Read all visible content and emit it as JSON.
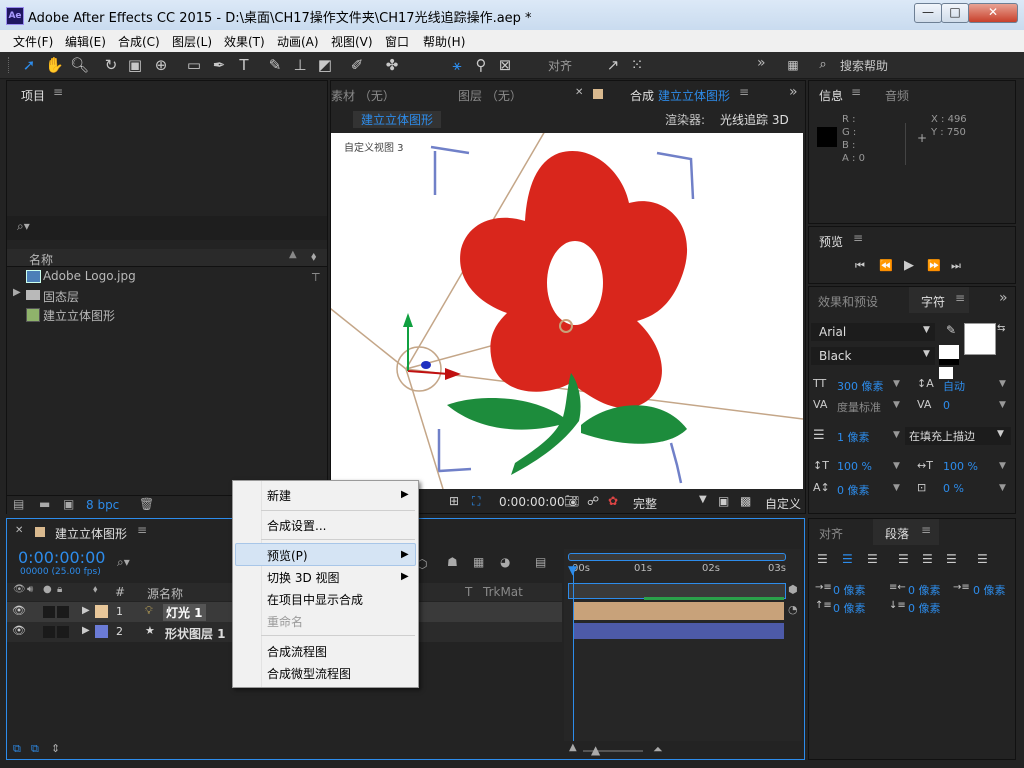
{
  "window": {
    "title": "Adobe After Effects CC 2015 - D:\\桌面\\CH17操作文件夹\\CH17光线追踪操作.aep *",
    "app_icon": "Ae",
    "min": "—",
    "max": "□",
    "close": "✕"
  },
  "menu": [
    "文件(F)",
    "编辑(E)",
    "合成(C)",
    "图层(L)",
    "效果(T)",
    "动画(A)",
    "视图(V)",
    "窗口",
    "帮助(H)"
  ],
  "toolbar": {
    "align_label": "对齐",
    "help_search_placeholder": "搜索帮助",
    "more": "»"
  },
  "project": {
    "tab": "项目",
    "col_name": "名称",
    "items": [
      {
        "name": "Adobe Logo.jpg",
        "type": "image"
      },
      {
        "name": "固态层",
        "type": "folder"
      },
      {
        "name": "建立立体图形",
        "type": "comp"
      }
    ],
    "bpc": "8 bpc"
  },
  "viewer": {
    "tabs": [
      "素材 （无）",
      "图层 （无）"
    ],
    "comp_tab_prefix": "合成",
    "comp_name": "建立立体图形",
    "breadcrumb": "建立立体图形",
    "renderer_label": "渲染器:",
    "renderer_value": "光线追踪 3D",
    "view_label": "自定义视图 3",
    "timecode": "0:00:00:00",
    "resolution": "完整",
    "view_mode": "自定义"
  },
  "info": {
    "tab": "信息",
    "tab2": "音频",
    "r": "R :",
    "g": "G :",
    "b": "B :",
    "a": "A : 0",
    "x": "X : 496",
    "y": "Y : 750"
  },
  "preview": {
    "tab": "预览"
  },
  "character": {
    "tab_effects": "效果和预设",
    "tab_char": "字符",
    "font": "Arial",
    "style": "Black",
    "size": "300 像素",
    "leading": "自动",
    "kerning": "度量标准",
    "tracking": "0",
    "stroke": "1 像素",
    "stroke_mode": "在填充上描边",
    "vscale": "100 %",
    "hscale": "100 %",
    "baseline": "0 像素",
    "tsume": "0 %"
  },
  "paragraph": {
    "tab_align": "对齐",
    "tab_para": "段落",
    "indent_left": "0 像素",
    "indent_right": "0 像素",
    "indent_first": "0 像素",
    "space_before": "0 像素",
    "space_after": "0 像素"
  },
  "timeline": {
    "comp_name": "建立立体图形",
    "timecode": "0:00:00:00",
    "frame_info": "00000 (25.00 fps)",
    "col_hash": "#",
    "col_source": "源名称",
    "col_trkmat": "TrkMat",
    "ruler": [
      "00s",
      "01s",
      "02s",
      "03s"
    ],
    "layers": [
      {
        "index": "1",
        "name": "灯光 1",
        "color": "#e8c79a",
        "icon": "light"
      },
      {
        "index": "2",
        "name": "形状图层 1",
        "color": "#6b7bd6",
        "icon": "shape"
      }
    ]
  },
  "context_menu": {
    "items": [
      {
        "label": "新建",
        "submenu": true
      },
      {
        "label": "合成设置...",
        "submenu": false
      },
      {
        "label": "预览(P)",
        "submenu": true,
        "highlighted": true
      },
      {
        "label": "切换 3D 视图",
        "submenu": true
      },
      {
        "label": "在项目中显示合成",
        "submenu": false
      },
      {
        "label": "重命名",
        "submenu": false,
        "disabled": true
      },
      {
        "label": "合成流程图",
        "submenu": false
      },
      {
        "label": "合成微型流程图",
        "submenu": false
      }
    ]
  },
  "colors": {
    "accent": "#2d8ceb",
    "petal": "#d9261c",
    "stem": "#1d8c3c",
    "light_bar": "#c8a27a",
    "shape_bar": "#4d5aa8"
  }
}
